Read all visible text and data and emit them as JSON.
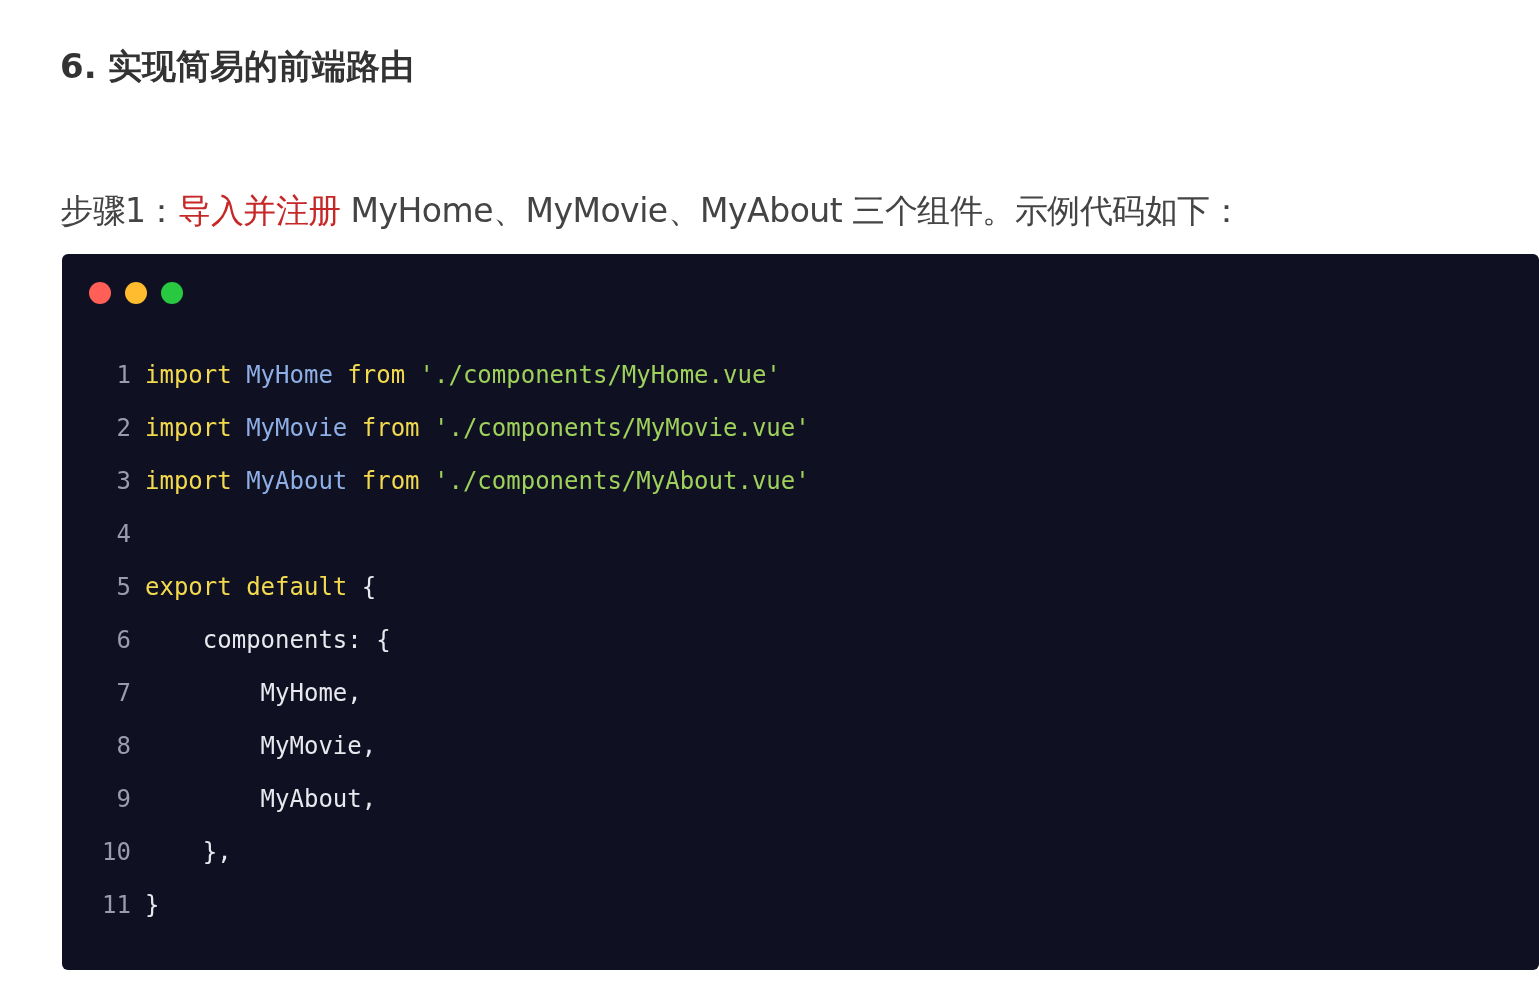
{
  "heading": "6. 实现简易的前端路由",
  "step": {
    "segments": [
      {
        "kind": "normal",
        "text": "步骤1："
      },
      {
        "kind": "highlight",
        "text": "导入并注册"
      },
      {
        "kind": "normal",
        "text": " MyHome、MyMovie、MyAbout 三个组件。示例代码如下："
      }
    ]
  },
  "code_window": {
    "lines": [
      {
        "number": "1",
        "tokens": [
          {
            "kind": "keyword",
            "text": "import"
          },
          {
            "kind": "identifier",
            "text": " MyHome"
          },
          {
            "kind": "keyword",
            "text": " from"
          },
          {
            "kind": "string",
            "text": " './components/MyHome.vue'"
          }
        ]
      },
      {
        "number": "2",
        "tokens": [
          {
            "kind": "keyword",
            "text": "import"
          },
          {
            "kind": "identifier",
            "text": " MyMovie"
          },
          {
            "kind": "keyword",
            "text": " from"
          },
          {
            "kind": "string",
            "text": " './components/MyMovie.vue'"
          }
        ]
      },
      {
        "number": "3",
        "tokens": [
          {
            "kind": "keyword",
            "text": "import"
          },
          {
            "kind": "identifier",
            "text": " MyAbout"
          },
          {
            "kind": "keyword",
            "text": " from"
          },
          {
            "kind": "string",
            "text": " './components/MyAbout.vue'"
          }
        ]
      },
      {
        "number": "4"
      },
      {
        "number": "5",
        "tokens": [
          {
            "kind": "keyword",
            "text": "export default"
          },
          {
            "kind": "plain",
            "text": " {"
          }
        ]
      },
      {
        "number": "6",
        "tokens": [
          {
            "kind": "plain",
            "text": "    components: {"
          }
        ]
      },
      {
        "number": "7",
        "tokens": [
          {
            "kind": "plain",
            "text": "        MyHome,"
          }
        ]
      },
      {
        "number": "8",
        "tokens": [
          {
            "kind": "plain",
            "text": "        MyMovie,"
          }
        ]
      },
      {
        "number": "9",
        "tokens": [
          {
            "kind": "plain",
            "text": "        MyAbout,"
          }
        ]
      },
      {
        "number": "10",
        "tokens": [
          {
            "kind": "plain",
            "text": "    },"
          }
        ]
      },
      {
        "number": "11",
        "tokens": [
          {
            "kind": "plain",
            "text": "}"
          }
        ]
      }
    ]
  }
}
